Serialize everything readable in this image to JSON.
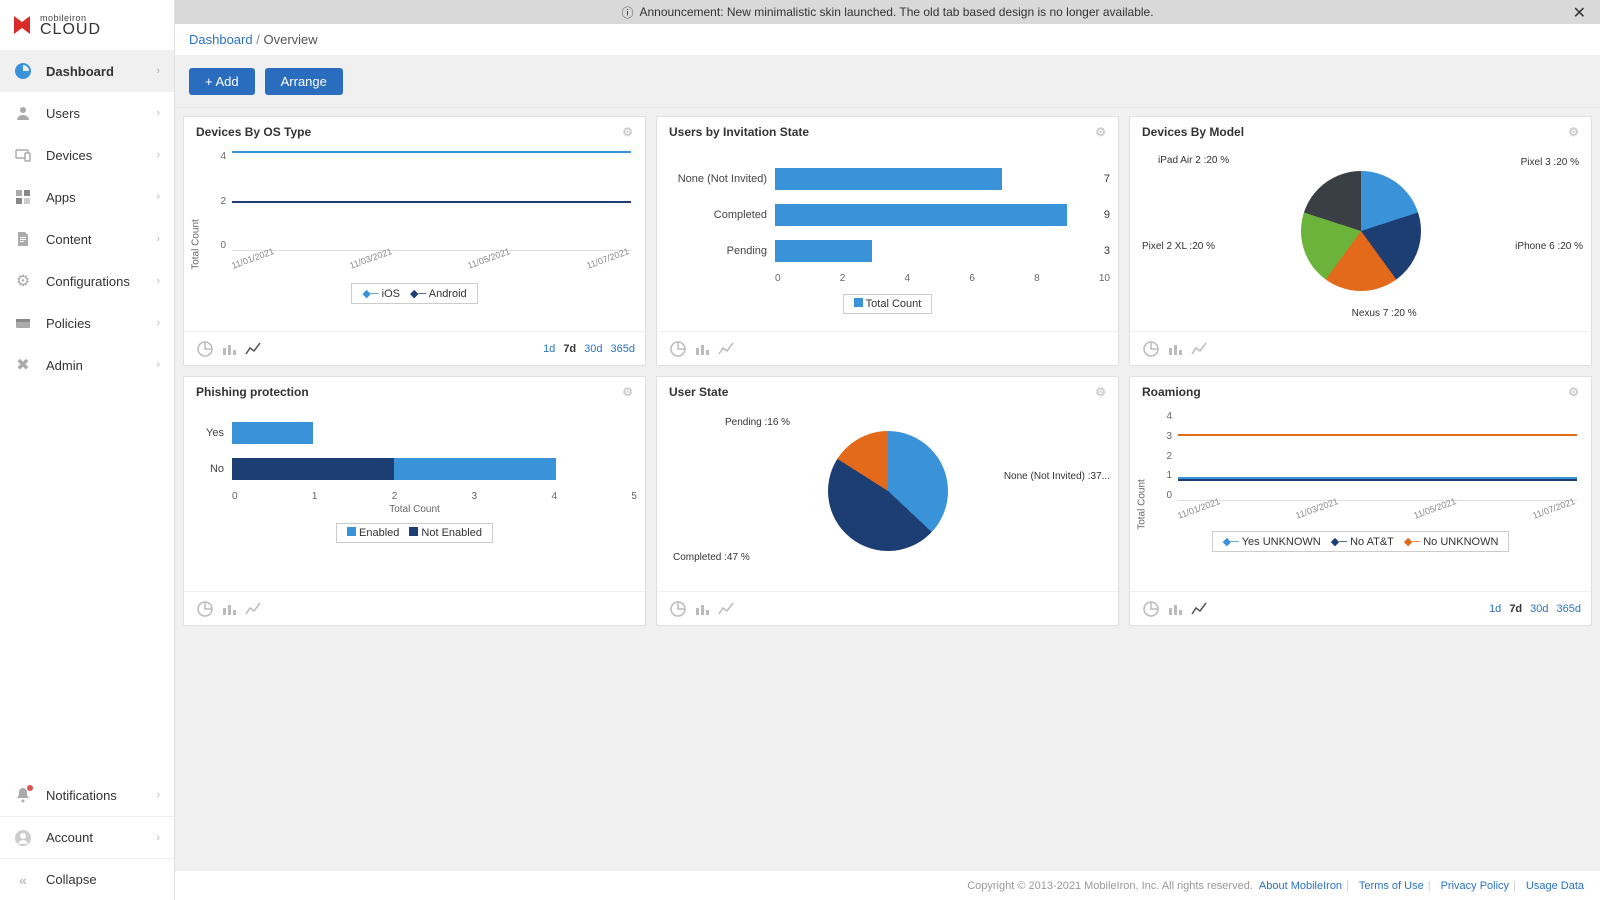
{
  "brand": {
    "small": "mobileiron",
    "big": "CLOUD"
  },
  "announcement": {
    "text": "Announcement: New minimalistic skin launched. The old tab based design is no longer available."
  },
  "breadcrumb": {
    "root": "Dashboard",
    "sep": "/",
    "current": "Overview"
  },
  "toolbar": {
    "add": "+ Add",
    "arrange": "Arrange"
  },
  "nav_main": [
    {
      "label": "Dashboard",
      "icon": "pie"
    },
    {
      "label": "Users",
      "icon": "user"
    },
    {
      "label": "Devices",
      "icon": "device"
    },
    {
      "label": "Apps",
      "icon": "apps"
    },
    {
      "label": "Content",
      "icon": "doc"
    },
    {
      "label": "Configurations",
      "icon": "gear"
    },
    {
      "label": "Policies",
      "icon": "policy"
    },
    {
      "label": "Admin",
      "icon": "admin"
    }
  ],
  "nav_bottom": [
    {
      "label": "Notifications",
      "icon": "bell",
      "dot": true
    },
    {
      "label": "Account",
      "icon": "avatar"
    },
    {
      "label": "Collapse",
      "icon": "collapse"
    }
  ],
  "timeframes": [
    "1d",
    "7d",
    "30d",
    "365d"
  ],
  "timeframe_active": "7d",
  "cards": {
    "os": {
      "title": "Devices By OS Type",
      "ylabel": "Total Count",
      "x": [
        "11/01/2021",
        "11/03/2021",
        "11/05/2021",
        "11/07/2021"
      ],
      "yticks": [
        "4",
        "2",
        "0"
      ],
      "legend": [
        "iOS",
        "Android"
      ]
    },
    "inv": {
      "title": "Users by Invitation State",
      "legend": "Total Count",
      "rows": [
        {
          "label": "None (Not Invited)",
          "val": 7
        },
        {
          "label": "Completed",
          "val": 9
        },
        {
          "label": "Pending",
          "val": 3
        }
      ],
      "xticks": [
        "0",
        "2",
        "4",
        "6",
        "8",
        "10"
      ]
    },
    "model": {
      "title": "Devices By Model",
      "slices": [
        {
          "label": "Pixel 3 :20 %",
          "color": "#3a93d8"
        },
        {
          "label": "iPhone 6 :20 %",
          "color": "#1c3e73"
        },
        {
          "label": "Nexus 7 :20 %",
          "color": "#e36a1a"
        },
        {
          "label": "Pixel 2 XL :20 %",
          "color": "#6bb33a"
        },
        {
          "label": "iPad Air 2 :20 %",
          "color": "#3a3f46"
        }
      ]
    },
    "phish": {
      "title": "Phishing protection",
      "xlabel": "Total Count",
      "legend": [
        "Enabled",
        "Not Enabled"
      ],
      "rows": [
        {
          "label": "Yes",
          "seg": [
            {
              "c": "#3a93d8",
              "v": 1
            }
          ]
        },
        {
          "label": "No",
          "seg": [
            {
              "c": "#1c3e73",
              "v": 2
            },
            {
              "c": "#3a93d8",
              "v": 2
            }
          ]
        }
      ],
      "xticks": [
        "0",
        "1",
        "2",
        "3",
        "4",
        "5"
      ]
    },
    "ustate": {
      "title": "User State",
      "slices": [
        {
          "label": "None (Not Invited) :37...",
          "color": "#3a93d8",
          "pct": 37
        },
        {
          "label": "Completed :47 %",
          "color": "#1c3e73",
          "pct": 47
        },
        {
          "label": "Pending :16 %",
          "color": "#e36a1a",
          "pct": 16
        }
      ]
    },
    "roam": {
      "title": "Roamiong",
      "ylabel": "Total Count",
      "yticks": [
        "4",
        "3",
        "2",
        "1",
        "0"
      ],
      "x": [
        "11/01/2021",
        "11/03/2021",
        "11/05/2021",
        "11/07/2021"
      ],
      "legend": [
        "Yes UNKNOWN",
        "No AT&T",
        "No UNKNOWN"
      ]
    }
  },
  "footer": {
    "copyright": "Copyright © 2013-2021 MobileIron, Inc. All rights reserved.",
    "links": [
      "About MobileIron",
      "Terms of Use",
      "Privacy Policy",
      "Usage Data"
    ]
  },
  "chart_data": [
    {
      "type": "line",
      "title": "Devices By OS Type",
      "x": [
        "11/01/2021",
        "11/03/2021",
        "11/05/2021",
        "11/07/2021"
      ],
      "series": [
        {
          "name": "iOS",
          "values": [
            4,
            4,
            4,
            4
          ]
        },
        {
          "name": "Android",
          "values": [
            2,
            2,
            2,
            2
          ]
        }
      ],
      "ylabel": "Total Count",
      "ylim": [
        0,
        4
      ]
    },
    {
      "type": "bar",
      "title": "Users by Invitation State",
      "orientation": "horizontal",
      "categories": [
        "None (Not Invited)",
        "Completed",
        "Pending"
      ],
      "values": [
        7,
        9,
        3
      ],
      "xlabel": "",
      "ylabel": "",
      "xlim": [
        0,
        10
      ],
      "legend": [
        "Total Count"
      ]
    },
    {
      "type": "pie",
      "title": "Devices By Model",
      "series": [
        {
          "name": "Pixel 3",
          "value": 20
        },
        {
          "name": "iPhone 6",
          "value": 20
        },
        {
          "name": "Nexus 7",
          "value": 20
        },
        {
          "name": "Pixel 2 XL",
          "value": 20
        },
        {
          "name": "iPad Air 2",
          "value": 20
        }
      ]
    },
    {
      "type": "bar",
      "title": "Phishing protection",
      "orientation": "horizontal",
      "stacked": true,
      "categories": [
        "Yes",
        "No"
      ],
      "series": [
        {
          "name": "Enabled",
          "values": [
            1,
            2
          ]
        },
        {
          "name": "Not Enabled",
          "values": [
            0,
            2
          ]
        }
      ],
      "xlabel": "Total Count",
      "xlim": [
        0,
        5
      ]
    },
    {
      "type": "pie",
      "title": "User State",
      "series": [
        {
          "name": "None (Not Invited)",
          "value": 37
        },
        {
          "name": "Completed",
          "value": 47
        },
        {
          "name": "Pending",
          "value": 16
        }
      ]
    },
    {
      "type": "line",
      "title": "Roamiong",
      "x": [
        "11/01/2021",
        "11/03/2021",
        "11/05/2021",
        "11/07/2021"
      ],
      "series": [
        {
          "name": "Yes UNKNOWN",
          "values": [
            1,
            1,
            1,
            1
          ]
        },
        {
          "name": "No AT&T",
          "values": [
            1,
            1,
            1,
            1
          ]
        },
        {
          "name": "No UNKNOWN",
          "values": [
            3,
            3,
            3,
            3
          ]
        }
      ],
      "ylabel": "Total Count",
      "ylim": [
        0,
        4
      ]
    }
  ]
}
